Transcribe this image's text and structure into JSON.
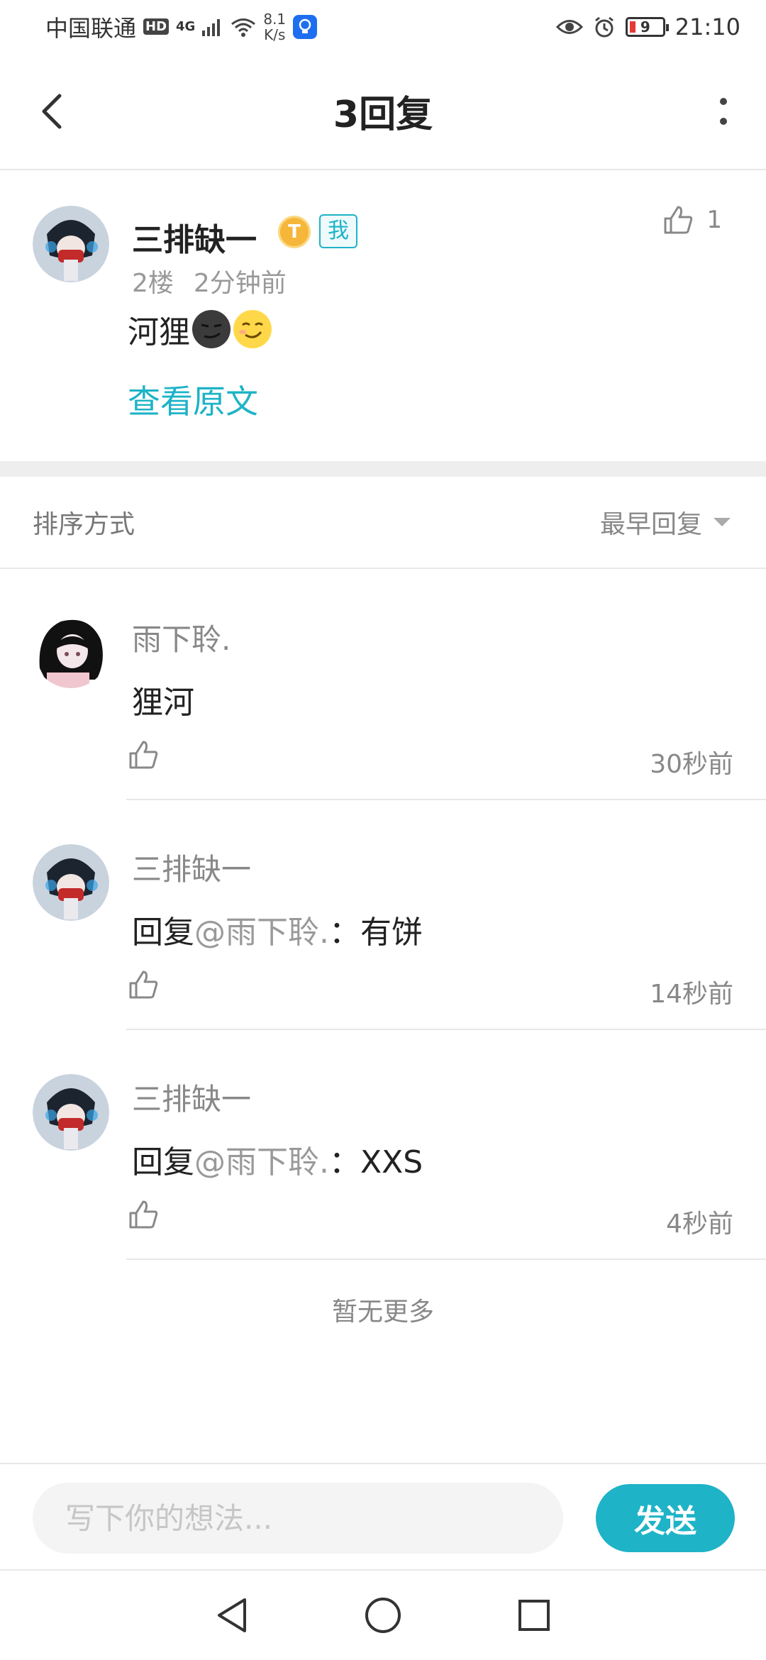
{
  "status_bar": {
    "carrier": "中国联通",
    "hd_badge": "HD",
    "network": "4G",
    "speed_value": "8.1",
    "speed_unit": "K/s",
    "battery": "9",
    "time": "21:10"
  },
  "header": {
    "title": "3回复",
    "back_icon": "chevron-left-icon",
    "more_icon": "more-vertical-icon"
  },
  "original_post": {
    "author": "三排缺一",
    "level_badge": "T",
    "me_tag": "我",
    "like_count": "1",
    "floor": "2楼",
    "time": "2分钟前",
    "content": "河狸",
    "view_original": "查看原文"
  },
  "sort": {
    "label": "排序方式",
    "selected": "最早回复"
  },
  "replies": [
    {
      "author": "雨下聆.",
      "prefix": "",
      "mention": "",
      "text": "狸河",
      "time": "30秒前"
    },
    {
      "author": "三排缺一",
      "prefix": "回复",
      "mention": "@雨下聆.",
      "text": "：有饼",
      "time": "14秒前"
    },
    {
      "author": "三排缺一",
      "prefix": "回复",
      "mention": "@雨下聆.",
      "text": "：XXS",
      "time": "4秒前"
    }
  ],
  "no_more": "暂无更多",
  "input": {
    "placeholder": "写下你的想法...",
    "send_label": "发送"
  },
  "colors": {
    "accent": "#1eb3c7",
    "divider": "#e8e8e8",
    "muted_text": "#888888"
  }
}
